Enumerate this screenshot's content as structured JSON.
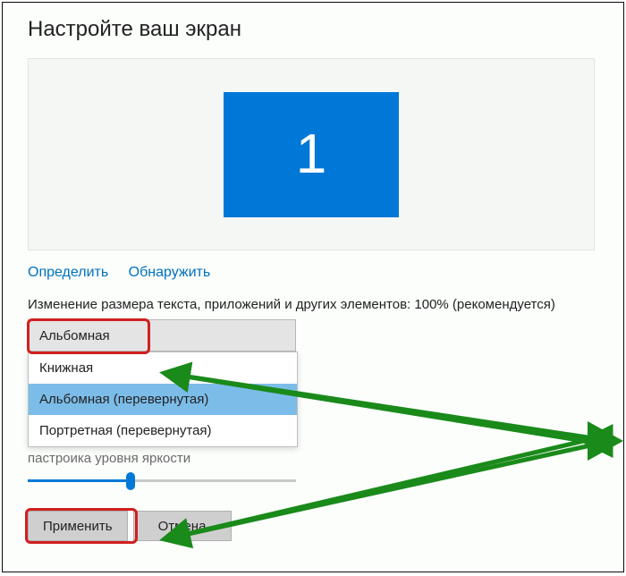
{
  "title": "Настройте ваш экран",
  "monitor_number": "1",
  "links": {
    "identify": "Определить",
    "detect": "Обнаружить"
  },
  "scaling_label": "Изменение размера текста, приложений и других элементов: 100% (рекомендуется)",
  "orientation": {
    "selected": "Альбомная",
    "options": [
      "Книжная",
      "Альбомная (перевернутая)",
      "Портретная (перевернутая)"
    ],
    "hovered_index": 1
  },
  "brightness_label": "пастроика уровня яркости",
  "slider_value": 38,
  "buttons": {
    "apply": "Применить",
    "cancel": "Отмена"
  }
}
